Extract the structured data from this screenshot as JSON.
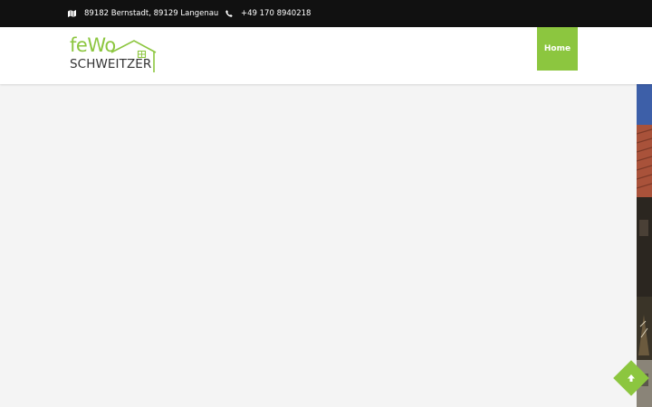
{
  "topbar": {
    "address_icon": "map-icon",
    "address": "89182 Bernstadt, 89129 Langenau",
    "phone_icon": "phone-icon",
    "phone": "+49 170 8940218"
  },
  "logo": {
    "line1": "feWo",
    "line2": "SCHWEITZER",
    "icon": "house-outline-icon"
  },
  "nav": {
    "home_label": "Home"
  },
  "scroll_top": {
    "icon": "arrow-up-icon"
  },
  "colors": {
    "accent": "#8cc63f",
    "topbar_bg": "#111111",
    "page_bg": "#f4f4f4",
    "header_bg": "#ffffff"
  }
}
